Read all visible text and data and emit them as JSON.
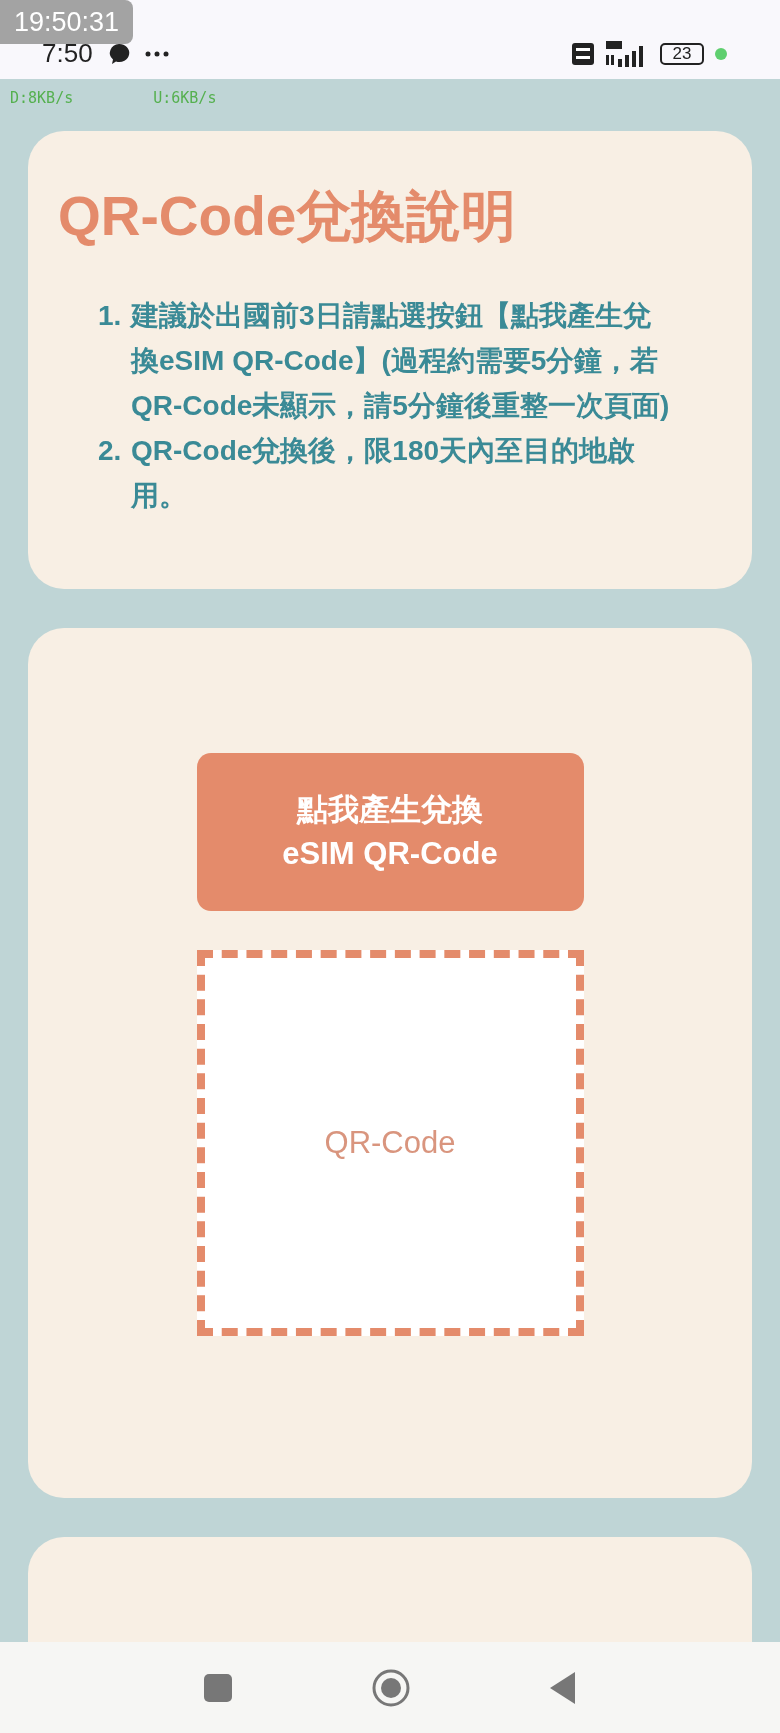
{
  "recording_clock": "19:50:31",
  "status_bar": {
    "time": "7:50",
    "battery": "23"
  },
  "speed_bar": {
    "download": "D:8KB/s",
    "upload": "U:6KB/s"
  },
  "instructions": {
    "title": "QR-Code兌換說明",
    "items": [
      {
        "number": "1.",
        "text": "建議於出國前3日請點選按鈕【點我產生兌換eSIM QR-Code】(過程約需要5分鐘，若QR-Code未顯示，請5分鐘後重整一次頁面)"
      },
      {
        "number": "2.",
        "text": "QR-Code兌換後，限180天內至目的地啟用。"
      }
    ]
  },
  "generator": {
    "button": "點我產生兌換\neSIM QR-Code",
    "qr_placeholder": "QR-Code"
  }
}
